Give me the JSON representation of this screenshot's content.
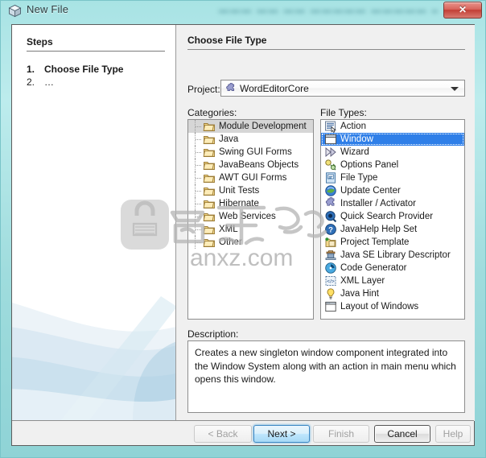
{
  "window": {
    "title": "New File",
    "icon": "cube-icon",
    "ghost_title": "▬▬▬ ▬▬ ▬▬ ▬▬▬▬▬ ▬▬▬▬▬ ▬▬",
    "close_label": "✕",
    "accent_color": "#2f7fe8",
    "titlebar_color": "#a8e3e4"
  },
  "steps": {
    "title": "Steps",
    "items": [
      {
        "num": "1.",
        "label": "Choose File Type",
        "active": true
      },
      {
        "num": "2.",
        "label": "…",
        "active": false
      }
    ]
  },
  "panel": {
    "title": "Choose File Type",
    "project_label": "Project:",
    "project_value": "WordEditorCore",
    "project_icon": "puzzle-piece-icon",
    "categories_label": "Categories:",
    "filetypes_label": "File Types:",
    "description_label": "Description:",
    "description_text": "Creates a new singleton window component integrated into the Window System along with an action in main menu which opens this window."
  },
  "categories": [
    {
      "label": "Module Development",
      "icon": "folder-icon",
      "selected": true
    },
    {
      "label": "Java",
      "icon": "folder-icon",
      "selected": false
    },
    {
      "label": "Swing GUI Forms",
      "icon": "folder-icon",
      "selected": false
    },
    {
      "label": "JavaBeans Objects",
      "icon": "folder-icon",
      "selected": false
    },
    {
      "label": "AWT GUI Forms",
      "icon": "folder-icon",
      "selected": false
    },
    {
      "label": "Unit Tests",
      "icon": "folder-icon",
      "selected": false
    },
    {
      "label": "Hibernate",
      "icon": "folder-icon",
      "selected": false
    },
    {
      "label": "Web Services",
      "icon": "folder-icon",
      "selected": false
    },
    {
      "label": "XML",
      "icon": "folder-icon",
      "selected": false
    },
    {
      "label": "Other",
      "icon": "folder-icon",
      "selected": false
    }
  ],
  "file_types": [
    {
      "label": "Action",
      "icon": "action-icon",
      "selected": false
    },
    {
      "label": "Window",
      "icon": "window-icon",
      "selected": true
    },
    {
      "label": "Wizard",
      "icon": "wizard-arrow-icon",
      "selected": false
    },
    {
      "label": "Options Panel",
      "icon": "options-panel-icon",
      "selected": false
    },
    {
      "label": "File Type",
      "icon": "file-type-icon",
      "selected": false
    },
    {
      "label": "Update Center",
      "icon": "update-center-icon",
      "selected": false
    },
    {
      "label": "Installer / Activator",
      "icon": "puzzle-piece-icon",
      "selected": false
    },
    {
      "label": "Quick Search Provider",
      "icon": "magnifier-icon",
      "selected": false
    },
    {
      "label": "JavaHelp Help Set",
      "icon": "help-question-icon",
      "selected": false
    },
    {
      "label": "Project Template",
      "icon": "project-template-icon",
      "selected": false
    },
    {
      "label": "Java SE Library Descriptor",
      "icon": "library-icon",
      "selected": false
    },
    {
      "label": "Code Generator",
      "icon": "code-generator-icon",
      "selected": false
    },
    {
      "label": "XML Layer",
      "icon": "xml-layer-icon",
      "selected": false
    },
    {
      "label": "Java Hint",
      "icon": "lightbulb-icon",
      "selected": false
    },
    {
      "label": "Layout of Windows",
      "icon": "layout-windows-icon",
      "selected": false
    }
  ],
  "buttons": {
    "back": "< Back",
    "next": "Next >",
    "finish": "Finish",
    "cancel": "Cancel",
    "help": "Help"
  },
  "watermark": {
    "text": "anxz.com"
  }
}
